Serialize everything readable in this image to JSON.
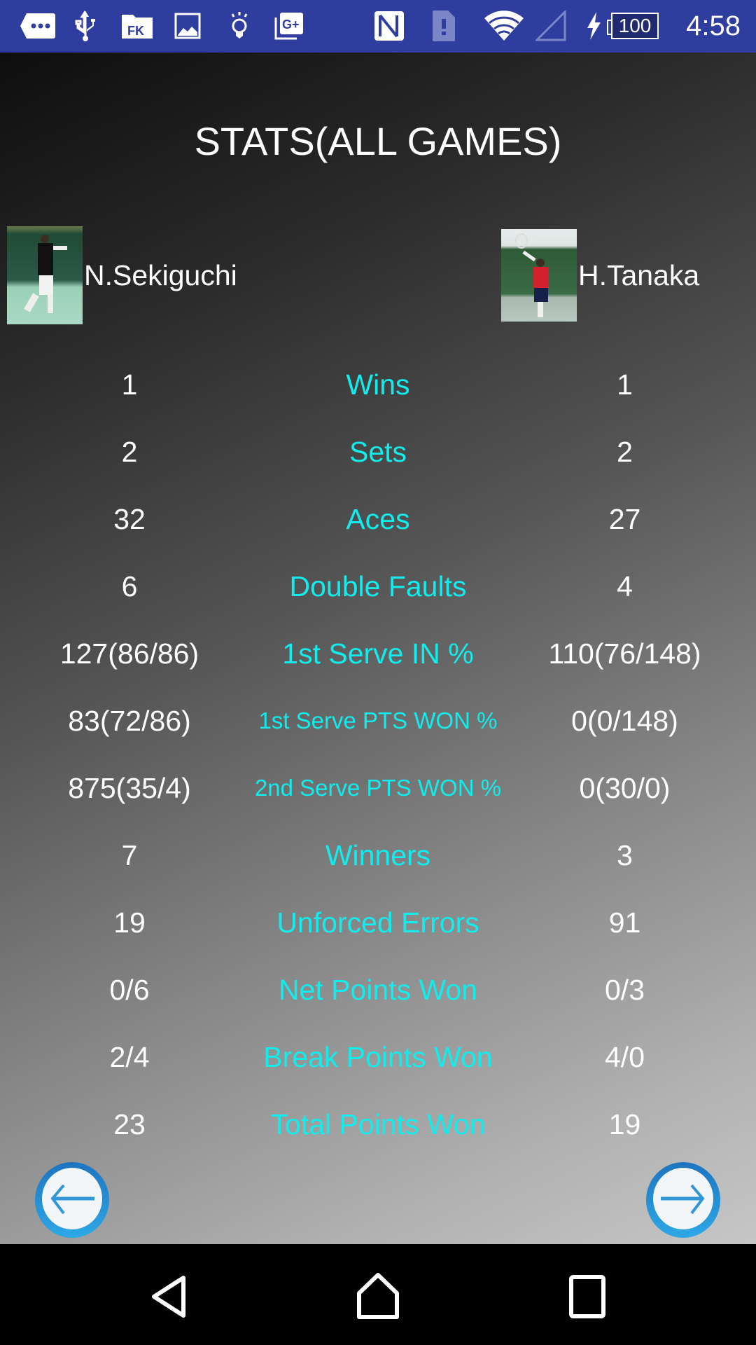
{
  "status_bar": {
    "left_icons": [
      "more-notifications-icon",
      "usb-icon",
      "fk-folder-icon",
      "image-icon",
      "lightbulb-icon",
      "google-plus-photos-icon"
    ],
    "right_icons": [
      "nfc-icon",
      "sim-alert-icon",
      "wifi-icon",
      "cell-signal-icon",
      "charging-icon"
    ],
    "battery": "100",
    "time": "4:58"
  },
  "page": {
    "title": "STATS(ALL GAMES)"
  },
  "players": {
    "left": {
      "name": "N.Sekiguchi"
    },
    "right": {
      "name": "H.Tanaka"
    }
  },
  "stats": [
    {
      "label": "Wins",
      "left": "1",
      "right": "1"
    },
    {
      "label": "Sets",
      "left": "2",
      "right": "2"
    },
    {
      "label": "Aces",
      "left": "32",
      "right": "27"
    },
    {
      "label": "Double Faults",
      "left": "6",
      "right": "4"
    },
    {
      "label": "1st Serve IN %",
      "left": "127(86/86)",
      "right": "110(76/148)"
    },
    {
      "label": "1st Serve PTS WON %",
      "left": "83(72/86)",
      "right": "0(0/148)"
    },
    {
      "label": "2nd Serve PTS WON %",
      "left": "875(35/4)",
      "right": "0(30/0)"
    },
    {
      "label": "Winners",
      "left": "7",
      "right": "3"
    },
    {
      "label": "Unforced Errors",
      "left": "19",
      "right": "91"
    },
    {
      "label": "Net Points Won",
      "left": "0/6",
      "right": "0/3"
    },
    {
      "label": "Break Points Won",
      "left": "2/4",
      "right": "4/0"
    },
    {
      "label": "Total Points Won",
      "left": "23",
      "right": "19"
    }
  ],
  "navigation": {
    "prev_icon": "arrow-left-icon",
    "next_icon": "arrow-right-icon"
  },
  "system_nav": [
    "back-icon",
    "home-icon",
    "recents-icon"
  ],
  "colors": {
    "status_bar": "#2f3e9e",
    "label_cyan": "#12ecec",
    "value_white": "#ffffff",
    "nav_button_blue": "#2a8fd6"
  }
}
